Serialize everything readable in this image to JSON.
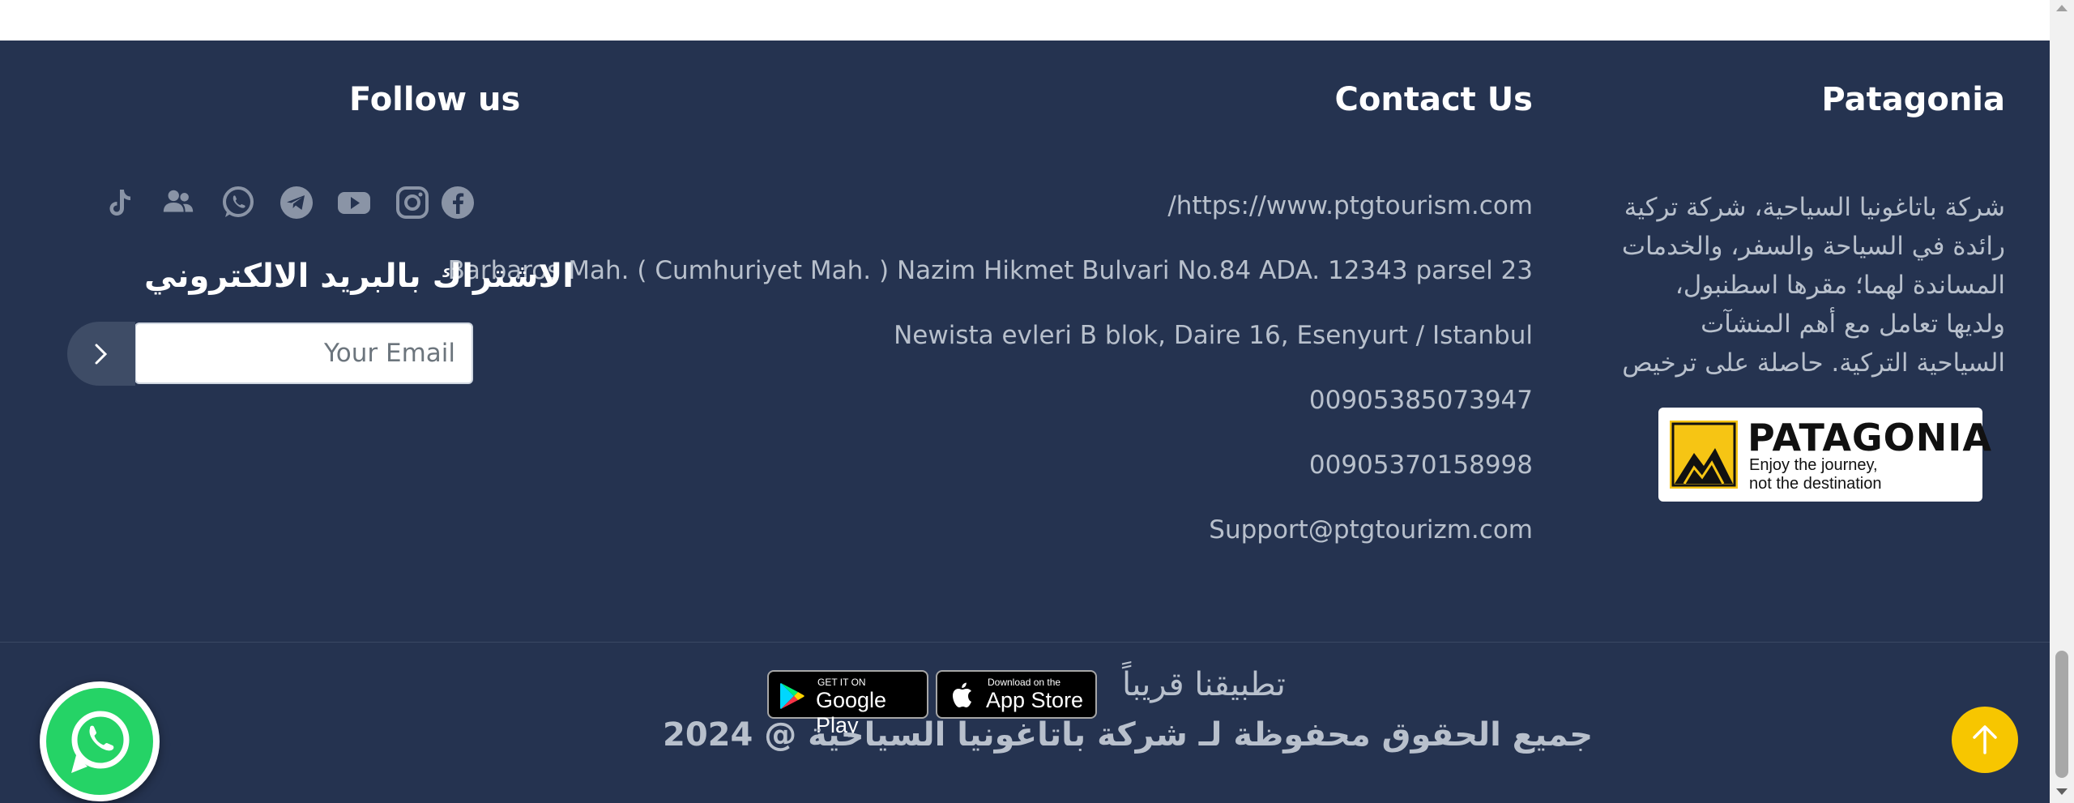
{
  "about": {
    "title": "Patagonia",
    "text": "شركة باتاغونيا السياحية، شركة تركية رائدة في السياحة والسفر، والخدمات المساندة لهما؛ مقرها اسطنبول، ولديها تعامل مع أهم المنشآت السياحية التركية. حاصلة على ترخيص",
    "logo_word": "PATAGONIA",
    "logo_tagline_1": "Enjoy the journey,",
    "logo_tagline_2": "not the destination"
  },
  "contact": {
    "title": "Contact Us",
    "website": "/https://www.ptgtourism.com",
    "address_1": "Barbaros Mah. ( Cumhuriyet Mah. ) Nazim Hikmet Bulvari No.84 ADA. 12343 parsel 23",
    "address_2": "Newista evleri B blok, Daire 16, Esenyurt / Istanbul",
    "phone_1": "00905385073947",
    "phone_2": "00905370158998",
    "email": "Support@ptgtourizm.com"
  },
  "follow": {
    "title": "Follow us",
    "icons": [
      "facebook-icon",
      "instagram-icon",
      "youtube-icon",
      "telegram-icon",
      "whatsapp-icon",
      "users-icon",
      "tiktok-icon"
    ],
    "newsletter_title": "الاشتراك بالبريد الالكتروني",
    "email_placeholder": "Your Email"
  },
  "bottom": {
    "apps_soon": "تطبيقنا قريباً",
    "app_store_small": "Download on the",
    "app_store_big": "App Store",
    "google_play_small": "GET IT ON",
    "google_play_big": "Google Play",
    "copyright": "جميع الحقوق محفوظة لـ شركة باتاغونيا السياحية @ 2024"
  },
  "colors": {
    "footer_bg": "#253350",
    "text": "#b8c0cc",
    "heading": "#ffffff",
    "accent_yellow": "#f7c600",
    "whatsapp_green": "#25d366"
  }
}
